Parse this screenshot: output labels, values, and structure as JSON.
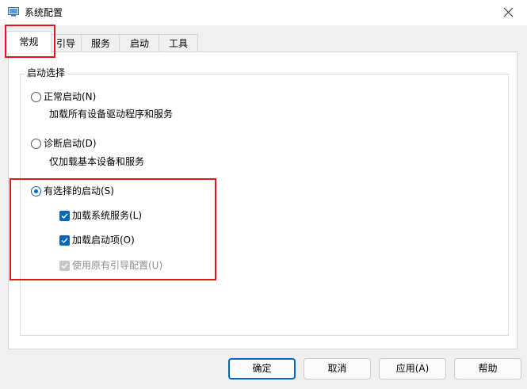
{
  "window": {
    "title": "系统配置"
  },
  "tabs": [
    {
      "label": "常规",
      "active": true
    },
    {
      "label": "引导",
      "active": false
    },
    {
      "label": "服务",
      "active": false
    },
    {
      "label": "启动",
      "active": false
    },
    {
      "label": "工具",
      "active": false
    }
  ],
  "startup_selection": {
    "group_label": "启动选择",
    "normal": {
      "label": "正常启动(N)",
      "description": "加载所有设备驱动程序和服务",
      "checked": false
    },
    "diagnostic": {
      "label": "诊断启动(D)",
      "description": "仅加载基本设备和服务",
      "checked": false
    },
    "selective": {
      "label": "有选择的启动(S)",
      "checked": true,
      "options": [
        {
          "label": "加载系统服务(L)",
          "checked": true,
          "enabled": true
        },
        {
          "label": "加载启动项(O)",
          "checked": true,
          "enabled": true
        },
        {
          "label": "使用原有引导配置(U)",
          "checked": true,
          "enabled": false
        }
      ]
    }
  },
  "buttons": {
    "ok": "确定",
    "cancel": "取消",
    "apply": "应用(A)",
    "help": "帮助"
  },
  "colors": {
    "accent": "#0067c0",
    "highlight": "#e8131a"
  },
  "icons": {
    "app": "system-config-icon",
    "close": "close-icon",
    "check": "checkmark-icon"
  }
}
